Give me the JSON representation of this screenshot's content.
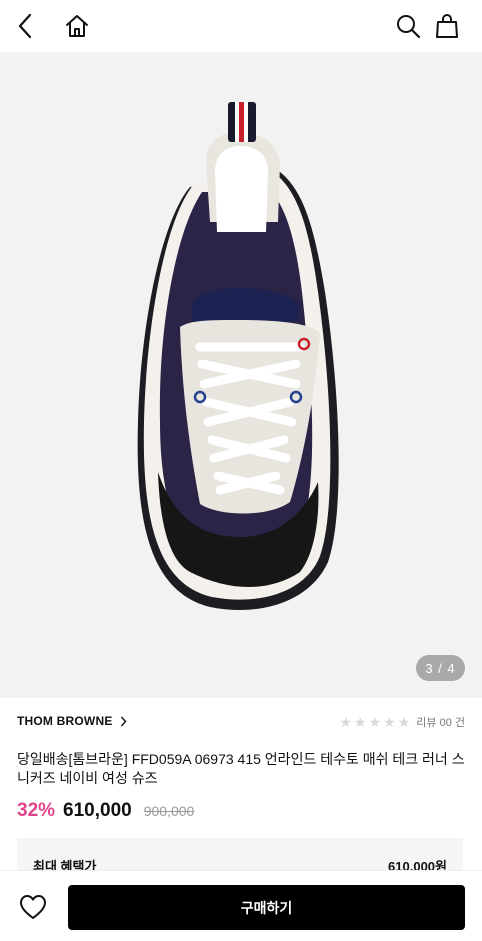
{
  "icons": {
    "back": "chevron-left-icon",
    "home": "home-icon",
    "search": "search-icon",
    "bag": "shopping-bag-icon",
    "wish": "heart-icon"
  },
  "gallery": {
    "pager": "3 / 4"
  },
  "product": {
    "brand": "THOM BROWNE",
    "review_label": "리뷰 00 건",
    "rating_stars": 0,
    "title": "당일배송[톰브라운] FFD059A 06973 415 언라인드 테수토 매쉬 테크 러너 스니커즈 네이비 여성 슈즈",
    "discount": "32%",
    "price": "610,000",
    "original_price": "900,000"
  },
  "benefit": {
    "label": "최대 혜택가",
    "value": "610,000원"
  },
  "actions": {
    "buy_label": "구매하기"
  },
  "colors": {
    "discount": "#e0458b",
    "buy_bg": "#000000",
    "image_bg": "#f2f2f2"
  }
}
